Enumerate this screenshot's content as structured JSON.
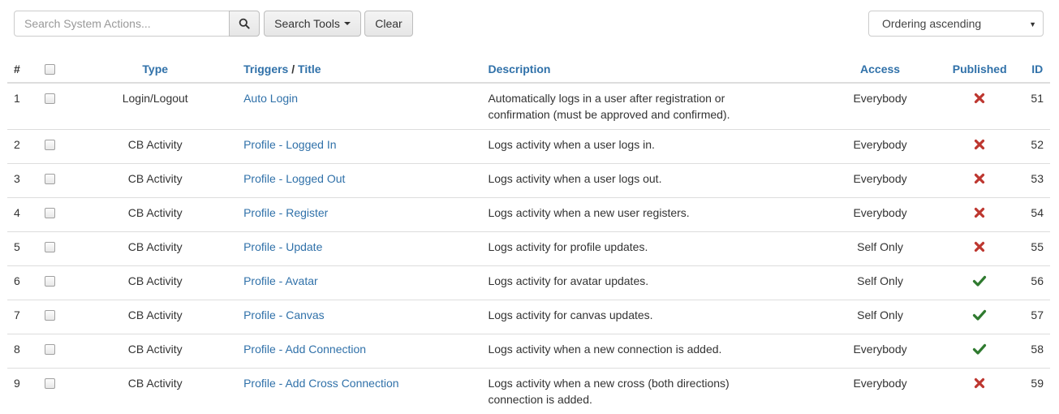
{
  "toolbar": {
    "search_placeholder": "Search System Actions...",
    "search_tools_label": "Search Tools",
    "clear_label": "Clear",
    "ordering_value": "Ordering ascending"
  },
  "table": {
    "headers": {
      "num": "#",
      "type": "Type",
      "triggers": "Triggers",
      "title_sep": " / ",
      "title": "Title",
      "description": "Description",
      "access": "Access",
      "published": "Published",
      "id": "ID"
    },
    "rows": [
      {
        "num": "1",
        "type": "Login/Logout",
        "title": "Auto Login",
        "description": "Automatically logs in a user after registration or confirmation (must be approved and confirmed).",
        "access": "Everybody",
        "published": false,
        "id": "51"
      },
      {
        "num": "2",
        "type": "CB Activity",
        "title": "Profile - Logged In",
        "description": "Logs activity when a user logs in.",
        "access": "Everybody",
        "published": false,
        "id": "52"
      },
      {
        "num": "3",
        "type": "CB Activity",
        "title": "Profile - Logged Out",
        "description": "Logs activity when a user logs out.",
        "access": "Everybody",
        "published": false,
        "id": "53"
      },
      {
        "num": "4",
        "type": "CB Activity",
        "title": "Profile - Register",
        "description": "Logs activity when a new user registers.",
        "access": "Everybody",
        "published": false,
        "id": "54"
      },
      {
        "num": "5",
        "type": "CB Activity",
        "title": "Profile - Update",
        "description": "Logs activity for profile updates.",
        "access": "Self Only",
        "published": false,
        "id": "55"
      },
      {
        "num": "6",
        "type": "CB Activity",
        "title": "Profile - Avatar",
        "description": "Logs activity for avatar updates.",
        "access": "Self Only",
        "published": true,
        "id": "56"
      },
      {
        "num": "7",
        "type": "CB Activity",
        "title": "Profile - Canvas",
        "description": "Logs activity for canvas updates.",
        "access": "Self Only",
        "published": true,
        "id": "57"
      },
      {
        "num": "8",
        "type": "CB Activity",
        "title": "Profile - Add Connection",
        "description": "Logs activity when a new connection is added.",
        "access": "Everybody",
        "published": true,
        "id": "58"
      },
      {
        "num": "9",
        "type": "CB Activity",
        "title": "Profile - Add Cross Connection",
        "description": "Logs activity when a new cross (both directions) connection is added.",
        "access": "Everybody",
        "published": false,
        "id": "59"
      }
    ]
  },
  "icons": {
    "search": "search-icon",
    "caret": "caret-down-icon",
    "published_yes": "check-icon",
    "published_no": "cross-icon"
  },
  "colors": {
    "link": "#3071a9",
    "unpublished": "#bd362f",
    "published": "#2f7a2f"
  }
}
